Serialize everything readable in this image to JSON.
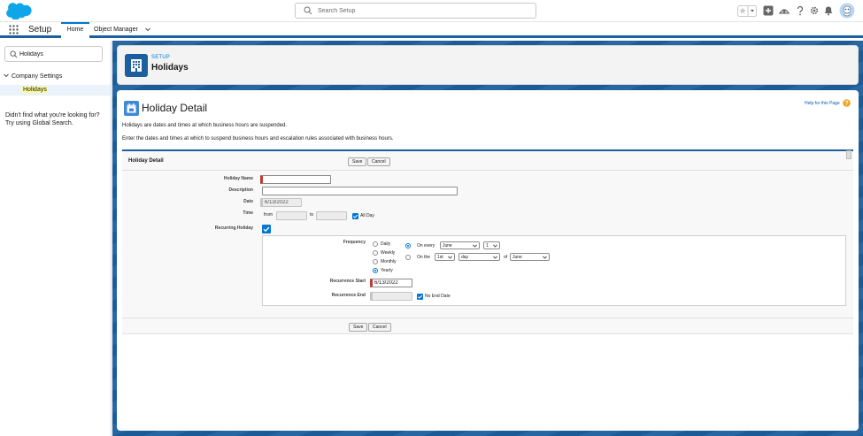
{
  "header": {
    "search_placeholder": "Search Setup"
  },
  "nav": {
    "app_name": "Setup",
    "tabs": [
      {
        "label": "Home",
        "active": true
      },
      {
        "label": "Object Manager",
        "active": false
      }
    ]
  },
  "sidebar": {
    "quick_find_value": "Holidays",
    "tree_parent": "Company Settings",
    "tree_child": "Holidays",
    "help_line_1": "Didn't find what you're looking for?",
    "help_line_2": "Try using Global Search."
  },
  "page_header": {
    "eyebrow": "SETUP",
    "title": "Holidays"
  },
  "content": {
    "title": "Holiday Detail",
    "help_link": "Help for this Page",
    "description_1": "Holidays are dates and times at which business hours are suspended.",
    "description_2": "Enter the dates and times at which to suspend business hours and escalation rules associated with business hours."
  },
  "detail": {
    "block_title": "Holiday Detail",
    "save_label": "Save",
    "cancel_label": "Cancel",
    "fields": {
      "holiday_name_label": "Holiday Name",
      "holiday_name_value": "",
      "description_label": "Description",
      "description_value": "",
      "date_label": "Date",
      "date_value": "6/13/2022",
      "time_label": "Time",
      "time_from": "from",
      "time_to": "to",
      "all_day_label": "All Day",
      "all_day_checked": true,
      "recurring_label": "Recurring Holiday",
      "recurring_checked": true
    },
    "recurrence": {
      "frequency_label": "Frequency",
      "frequencies": [
        "Daily",
        "Weekly",
        "Monthly",
        "Yearly"
      ],
      "selected_frequency": "Yearly",
      "on_every_label": "On every",
      "on_every_month": "June",
      "on_every_day": "1",
      "on_the_label": "On the",
      "on_the_ordinal": "1st",
      "on_the_unit": "day",
      "of_label": "of",
      "on_the_month": "June",
      "start_label": "Recurrence Start",
      "start_value": "6/13/2022",
      "end_label": "Recurrence End",
      "end_value": "",
      "no_end_label": "No End Date",
      "no_end_checked": true
    }
  },
  "colors": {
    "brand_blue": "#0176d3",
    "header_blue": "#1b5f9e",
    "required_red": "#c23934",
    "highlight_yellow": "#fdfd96"
  }
}
